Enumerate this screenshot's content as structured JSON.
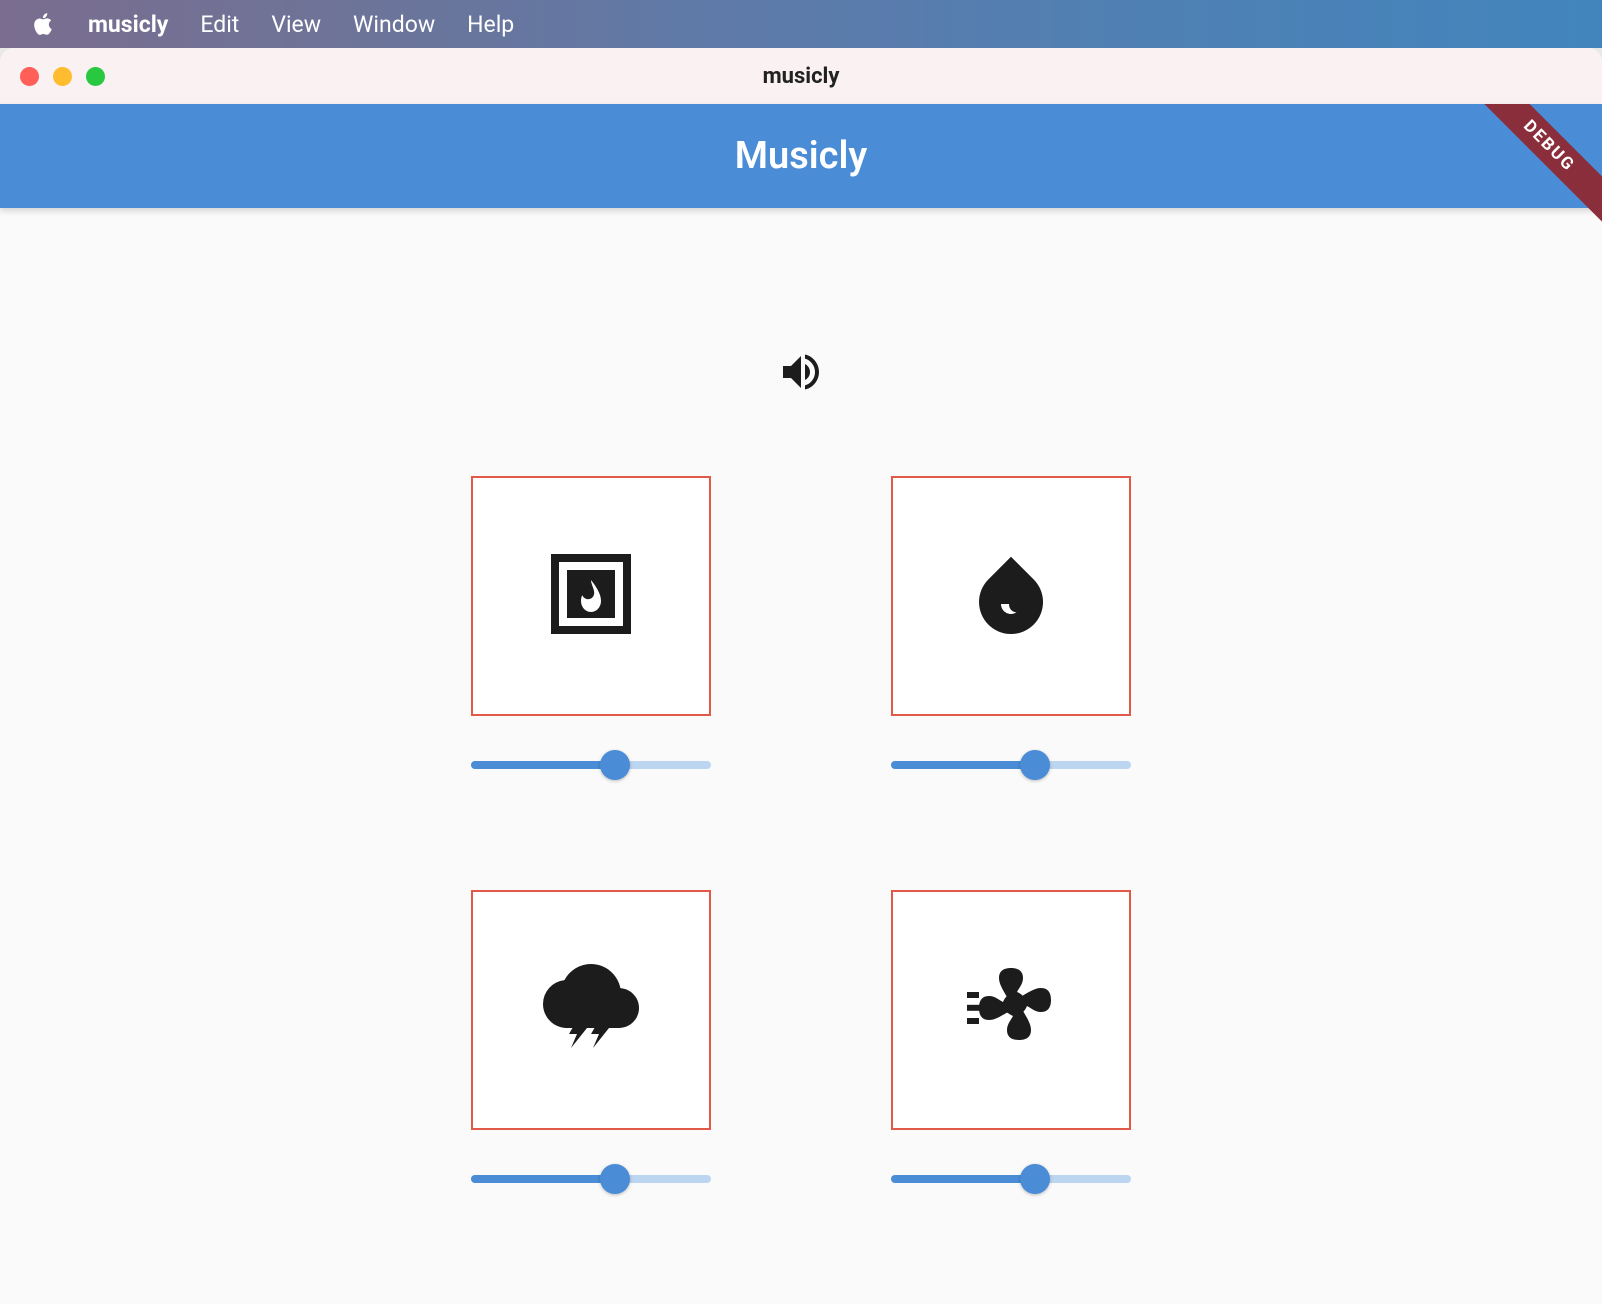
{
  "menubar": {
    "app_name": "musicly",
    "items": [
      "Edit",
      "View",
      "Window",
      "Help"
    ]
  },
  "window": {
    "title": "musicly"
  },
  "appbar": {
    "title": "Musicly",
    "debug_label": "DEBUG"
  },
  "top_icon": "volume-up-icon",
  "sounds": [
    {
      "name": "fireplace",
      "icon": "fireplace-icon",
      "volume": 60
    },
    {
      "name": "water",
      "icon": "water-drop-icon",
      "volume": 60
    },
    {
      "name": "thunderstorm",
      "icon": "thunderstorm-icon",
      "volume": 60
    },
    {
      "name": "fan",
      "icon": "fan-icon",
      "volume": 60
    }
  ],
  "colors": {
    "accent": "#4a8cd6",
    "tile_border": "#e05a47",
    "debug_banner": "#8a2e3b"
  }
}
